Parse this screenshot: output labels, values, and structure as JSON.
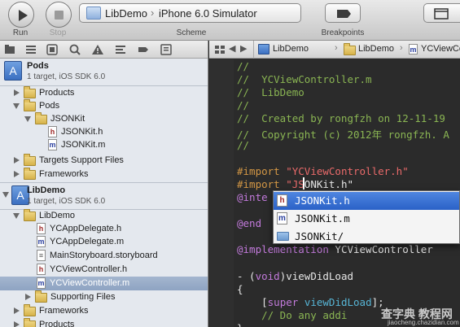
{
  "toolbar": {
    "run_label": "Run",
    "stop_label": "Stop",
    "scheme_label": "Scheme",
    "scheme_project": "LibDemo",
    "scheme_destination": "iPhone 6.0 Simulator",
    "breakpoints_label": "Breakpoints"
  },
  "navigator": {
    "tabs": [
      "folder-icon",
      "list-icon",
      "symbol-icon",
      "search-icon",
      "warning-icon",
      "breakpoint-icon",
      "log-icon"
    ],
    "tree": [
      {
        "label": "Pods",
        "subtitle": "1 target, iOS SDK 6.0",
        "kind": "project"
      },
      {
        "label": "Products",
        "kind": "folder",
        "state": "closed"
      },
      {
        "label": "Pods",
        "kind": "folder",
        "state": "open"
      },
      {
        "label": "JSONKit",
        "kind": "folder",
        "state": "open"
      },
      {
        "label": "JSONKit.h",
        "kind": "h"
      },
      {
        "label": "JSONKit.m",
        "kind": "m"
      },
      {
        "label": "Targets Support Files",
        "kind": "folder",
        "state": "closed"
      },
      {
        "label": "Frameworks",
        "kind": "folder",
        "state": "closed"
      },
      {
        "label": "LibDemo",
        "subtitle": "1 target, iOS SDK 6.0",
        "kind": "project"
      },
      {
        "label": "LibDemo",
        "kind": "folder",
        "state": "open"
      },
      {
        "label": "YCAppDelegate.h",
        "kind": "h"
      },
      {
        "label": "YCAppDelegate.m",
        "kind": "m"
      },
      {
        "label": "MainStoryboard.storyboard",
        "kind": "sb"
      },
      {
        "label": "YCViewController.h",
        "kind": "h"
      },
      {
        "label": "YCViewController.m",
        "kind": "m",
        "selected": true
      },
      {
        "label": "Supporting Files",
        "kind": "folder",
        "state": "closed"
      },
      {
        "label": "Frameworks",
        "kind": "folder",
        "state": "closed"
      },
      {
        "label": "Products",
        "kind": "folder",
        "state": "closed"
      }
    ]
  },
  "jumpbar": {
    "crumbs": [
      "LibDemo",
      "LibDemo",
      "YCViewCo"
    ]
  },
  "editor": {
    "lines": [
      {
        "parts": [
          {
            "t": "//",
            "c": "cm"
          }
        ]
      },
      {
        "parts": [
          {
            "t": "//  YCViewController.m",
            "c": "cm"
          }
        ]
      },
      {
        "parts": [
          {
            "t": "//  LibDemo",
            "c": "cm"
          }
        ]
      },
      {
        "parts": [
          {
            "t": "//",
            "c": "cm"
          }
        ]
      },
      {
        "parts": [
          {
            "t": "//  Created by rongfzh on 12-11-19",
            "c": "cm"
          }
        ]
      },
      {
        "parts": [
          {
            "t": "//  Copyright (c) 2012年 rongfzh. A",
            "c": "cm"
          }
        ]
      },
      {
        "parts": [
          {
            "t": "//",
            "c": "cm"
          }
        ]
      },
      {
        "parts": [
          {
            "t": "",
            "c": "pl"
          }
        ]
      },
      {
        "parts": [
          {
            "t": "#import ",
            "c": "pp"
          },
          {
            "t": "\"YCViewController.h\"",
            "c": "str"
          }
        ]
      },
      {
        "parts": [
          {
            "t": "#import ",
            "c": "pp"
          },
          {
            "t": "\"JS",
            "c": "str"
          },
          {
            "t": "ONKit.h\"",
            "c": "pl"
          }
        ]
      },
      {
        "parts": [
          {
            "t": "@inte",
            "c": "kw"
          }
        ]
      },
      {
        "parts": [
          {
            "t": "",
            "c": "pl"
          }
        ]
      },
      {
        "parts": [
          {
            "t": "@end",
            "c": "kw"
          }
        ]
      },
      {
        "parts": [
          {
            "t": "",
            "c": "pl"
          }
        ]
      },
      {
        "parts": [
          {
            "t": "@implementation ",
            "c": "kw"
          },
          {
            "t": "YCViewController",
            "c": "pl"
          }
        ]
      },
      {
        "parts": [
          {
            "t": "",
            "c": "pl"
          }
        ]
      },
      {
        "parts": [
          {
            "t": "- (",
            "c": "pl"
          },
          {
            "t": "void",
            "c": "kw"
          },
          {
            "t": ")viewDidLoad",
            "c": "pl"
          }
        ]
      },
      {
        "parts": [
          {
            "t": "{",
            "c": "pl"
          }
        ]
      },
      {
        "parts": [
          {
            "t": "    [",
            "c": "pl"
          },
          {
            "t": "super",
            "c": "kw"
          },
          {
            "t": " ",
            "c": "pl"
          },
          {
            "t": "viewDidLoad",
            "c": "fn"
          },
          {
            "t": "];",
            "c": "pl"
          }
        ]
      },
      {
        "parts": [
          {
            "t": "    // Do any addi",
            "c": "cm"
          }
        ]
      },
      {
        "parts": [
          {
            "t": "}",
            "c": "pl"
          }
        ]
      }
    ]
  },
  "autocomplete": {
    "items": [
      {
        "label": "JSONKit.h",
        "kind": "h",
        "selected": true
      },
      {
        "label": "JSONKit.m",
        "kind": "m"
      },
      {
        "label": "JSONKit/",
        "kind": "folder"
      }
    ]
  },
  "watermark": {
    "line1": "查字典 教程网",
    "line2": "jiaocheng.chazidian.com"
  }
}
